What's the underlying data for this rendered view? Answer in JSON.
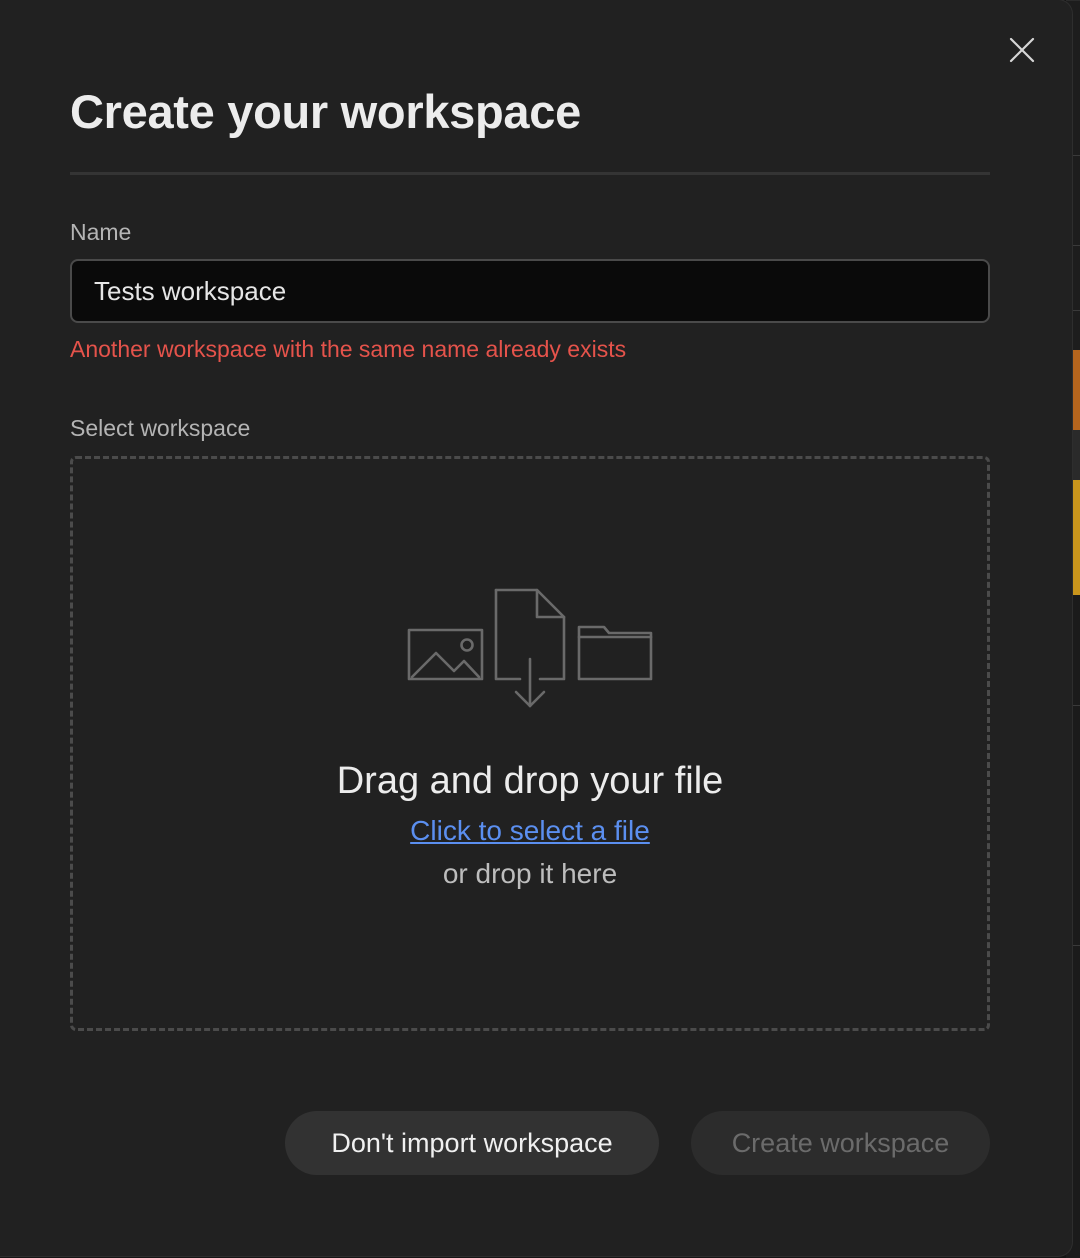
{
  "dialog": {
    "title": "Create your workspace",
    "close_icon": "close-icon"
  },
  "name_field": {
    "label": "Name",
    "value": "Tests workspace",
    "error": "Another workspace with the same name already exists"
  },
  "select_field": {
    "label": "Select workspace"
  },
  "dropzone": {
    "icon": "image-file-folder-upload-icon",
    "headline": "Drag and drop your file",
    "link": "Click to select a file",
    "subtext": "or drop it here"
  },
  "actions": {
    "secondary_label": "Don't import workspace",
    "primary_label": "Create workspace",
    "primary_disabled": true
  },
  "colors": {
    "error": "#e5534b",
    "link": "#5b8ff0",
    "background": "#212121"
  }
}
